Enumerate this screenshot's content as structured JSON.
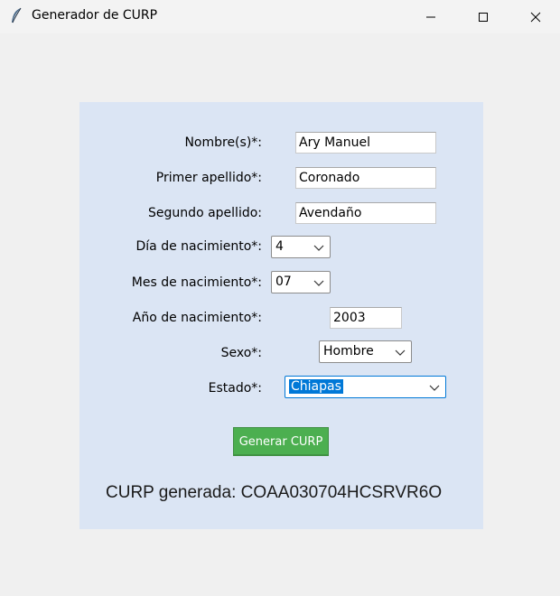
{
  "window": {
    "title": "Generador de CURP",
    "icon": "feather-icon",
    "controls": [
      "minimize-icon",
      "maximize-icon",
      "close-icon"
    ]
  },
  "form": {
    "nombre": {
      "label": "Nombre(s)*:",
      "value": "Ary Manuel"
    },
    "primer_apellido": {
      "label": "Primer apellido*:",
      "value": "Coronado"
    },
    "segundo_apellido": {
      "label": "Segundo apellido:",
      "value": "Avendaño"
    },
    "dia": {
      "label": "Día de nacimiento*:",
      "value": "4"
    },
    "mes": {
      "label": "Mes de nacimiento*:",
      "value": "07"
    },
    "anio": {
      "label": "Año de nacimiento*:",
      "value": "2003"
    },
    "sexo": {
      "label": "Sexo*:",
      "value": "Hombre"
    },
    "estado": {
      "label": "Estado*:",
      "value": "Chiapas"
    },
    "submit_label": "Generar CURP",
    "result_text": "CURP generada: COAA030704HCSRVR6O"
  },
  "colors": {
    "panel_bg": "#dbe5f4",
    "window_bg": "#f0f0f0",
    "button_bg": "#4caf50",
    "selection": "#0078d7"
  }
}
